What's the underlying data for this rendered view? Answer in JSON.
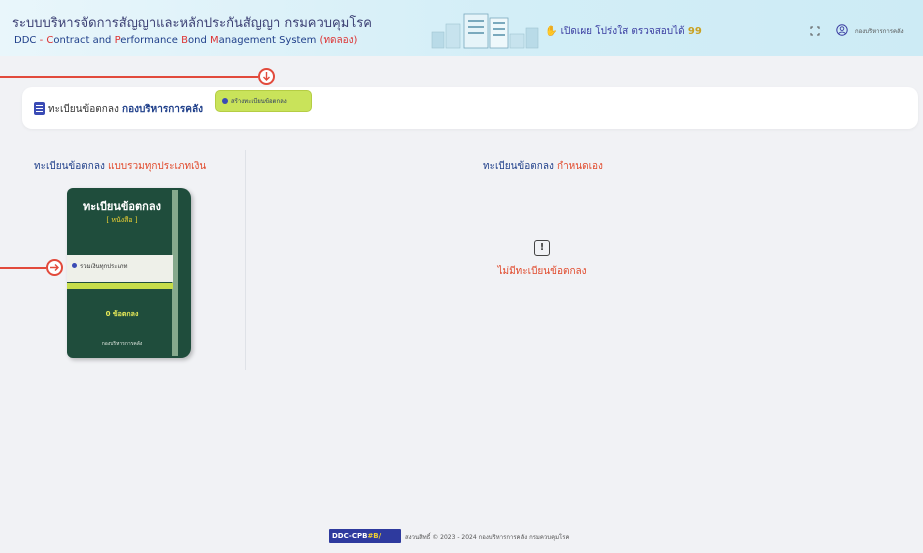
{
  "header": {
    "title": "ระบบบริหารจัดการสัญญาและหลักประกันสัญญา กรมควบคุมโรค",
    "subtitle_ddc": "DDC",
    "subtitle_rest": "ontract and ",
    "subtitle_c": "C",
    "subtitle_p": "P",
    "subtitle_erformance": "erformance ",
    "subtitle_b": "B",
    "subtitle_ond": "ond ",
    "subtitle_m": "M",
    "subtitle_anagement": "anagement System ",
    "subtitle_trial": "(ทดลอง)",
    "campaign": "เปิดเผย โปร่งใส ตรวจสอบได้",
    "campaign_quote": "99",
    "user_name": "กองบริหารการคลัง",
    "fullscreen_icon": "fullscreen-icon",
    "user_icon": "user-circle-icon"
  },
  "toolbar": {
    "label_prefix": "ทะเบียนข้อตกลง",
    "label_dept": "กองบริหารการคลัง",
    "create_button": "สร้างทะเบียนข้อตกลง",
    "icon": "document-icon"
  },
  "left_panel": {
    "title_main": "ทะเบียนข้อตกลง",
    "title_accent": "แบบรวมทุกประเภทเงิน",
    "book": {
      "title": "ทะเบียนข้อตกลง",
      "subtitle": "[ หนังสือ ]",
      "band_text": "รวมเงินทุกประเภท",
      "count": "0 ข้อตกลง",
      "footer": "กองบริหารการคลัง"
    }
  },
  "right_panel": {
    "title_main": "ทะเบียนข้อตกลง",
    "title_accent": "กำหนดเอง",
    "empty_icon": "alert-icon",
    "empty_text": "ไม่มีทะเบียนข้อตกลง"
  },
  "footer": {
    "badge_a": "DDC-CPB",
    "badge_b": "#B/",
    "text": "สงวนสิทธิ์ © 2023 - 2024 กองบริหารการคลัง กรมควบคุมโรค"
  },
  "colors": {
    "accent_blue": "#1f3f8a",
    "accent_red": "#e14a2c",
    "book_green": "#1f4d3c",
    "button_lime": "#c9e35a"
  }
}
